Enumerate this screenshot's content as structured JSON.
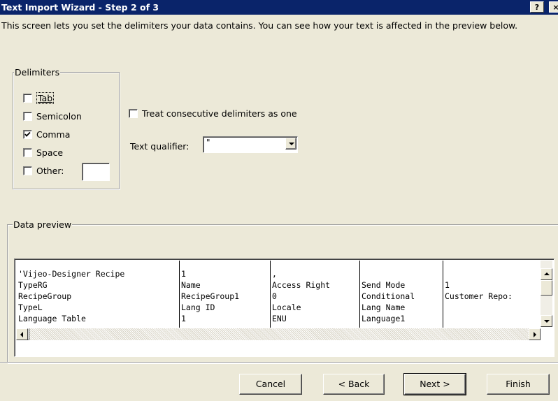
{
  "window": {
    "title": "Text Import Wizard - Step 2 of 3",
    "help_label": "?",
    "close_label": "×"
  },
  "description": "This screen lets you set the delimiters your data contains.  You can see how your text is affected in the preview below.",
  "delimiters": {
    "group_label": "Delimiters",
    "options": [
      {
        "label": "Tab",
        "checked": false
      },
      {
        "label": "Semicolon",
        "checked": false
      },
      {
        "label": "Comma",
        "checked": true
      },
      {
        "label": "Space",
        "checked": false
      },
      {
        "label": "Other:",
        "checked": false
      }
    ],
    "other_value": ""
  },
  "consecutive": {
    "label": "Treat consecutive delimiters as one",
    "checked": false
  },
  "text_qualifier": {
    "label": "Text qualifier:",
    "value": "\""
  },
  "preview": {
    "group_label": "Data preview",
    "rows": [
      [
        "'Vijeo-Designer Recipe",
        "1",
        ",",
        "",
        ""
      ],
      [
        "TypeRG",
        "Name",
        "Access Right",
        "Send Mode",
        "1"
      ],
      [
        "RecipeGroup",
        "RecipeGroup1",
        "0",
        "Conditional",
        "Customer Repo:"
      ],
      [
        "TypeL",
        "Lang ID",
        "Locale",
        "Lang Name",
        ""
      ],
      [
        "Language Table",
        "1",
        "ENU",
        "Language1",
        ""
      ]
    ]
  },
  "buttons": {
    "cancel": "Cancel",
    "back": "< Back",
    "next": "Next >",
    "finish": "Finish"
  },
  "colors": {
    "titlebar": "#0A246A",
    "dialog_bg": "#ECE9D8"
  }
}
